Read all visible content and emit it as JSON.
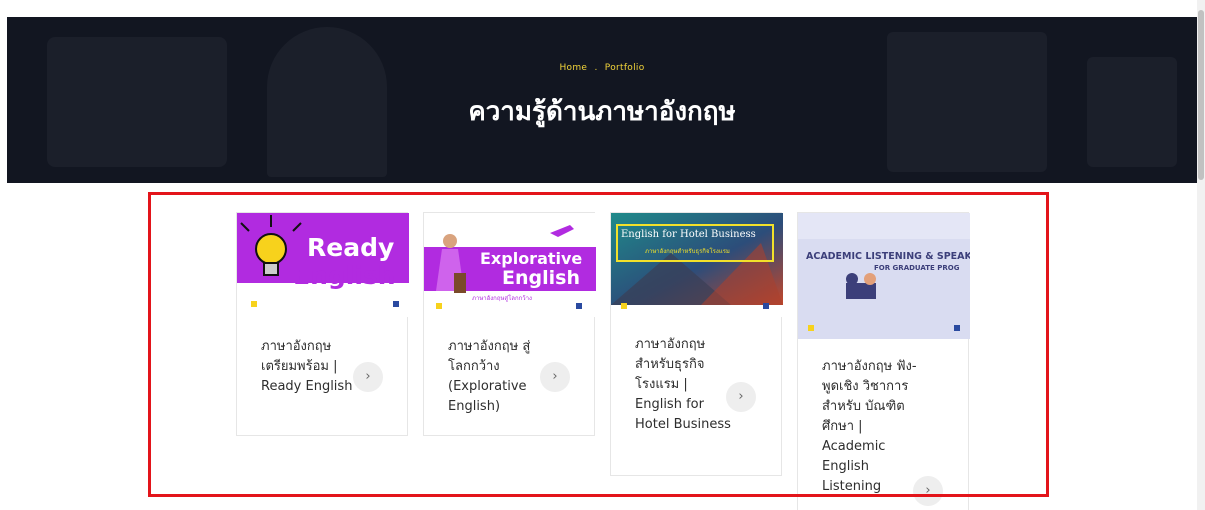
{
  "hero": {
    "breadcrumb_home": "Home",
    "breadcrumb_sep": ".",
    "breadcrumb_current": "Portfolio",
    "title": "ความรู้ด้านภาษาอังกฤษ"
  },
  "cards": [
    {
      "thumb_title_1": "Ready",
      "thumb_title_2": "English",
      "text": "ภาษาอังกฤษ เตรียมพร้อม | Ready English",
      "arrow": "›"
    },
    {
      "thumb_title_1": "Explorative",
      "thumb_title_2": "English",
      "thumb_sub": "ภาษาอังกฤษสู่โลกกว้าง",
      "text": "ภาษาอังกฤษ สู่โลกกว้าง (Explorative English)",
      "arrow": "›"
    },
    {
      "thumb_title": "English for Hotel Business",
      "thumb_sub": "ภาษาอังกฤษสำหรับธุรกิจโรงแรม",
      "text": "ภาษาอังกฤษ สำหรับธุรกิจ โรงแรม | English for Hotel Business",
      "arrow": "›"
    },
    {
      "thumb_title": "ACADEMIC LISTENING & SPEAKI",
      "thumb_sub": "FOR GRADUATE PROG",
      "text": "ภาษาอังกฤษ ฟัง-พูดเชิง วิชาการ สำหรับ บัณฑิตศึกษา | Academic English Listening",
      "arrow": "›"
    }
  ],
  "colors": {
    "hero_bg": "#121621",
    "breadcrumb": "#f2d43a",
    "highlight_border": "#e3141a",
    "purple": "#b12be0"
  }
}
